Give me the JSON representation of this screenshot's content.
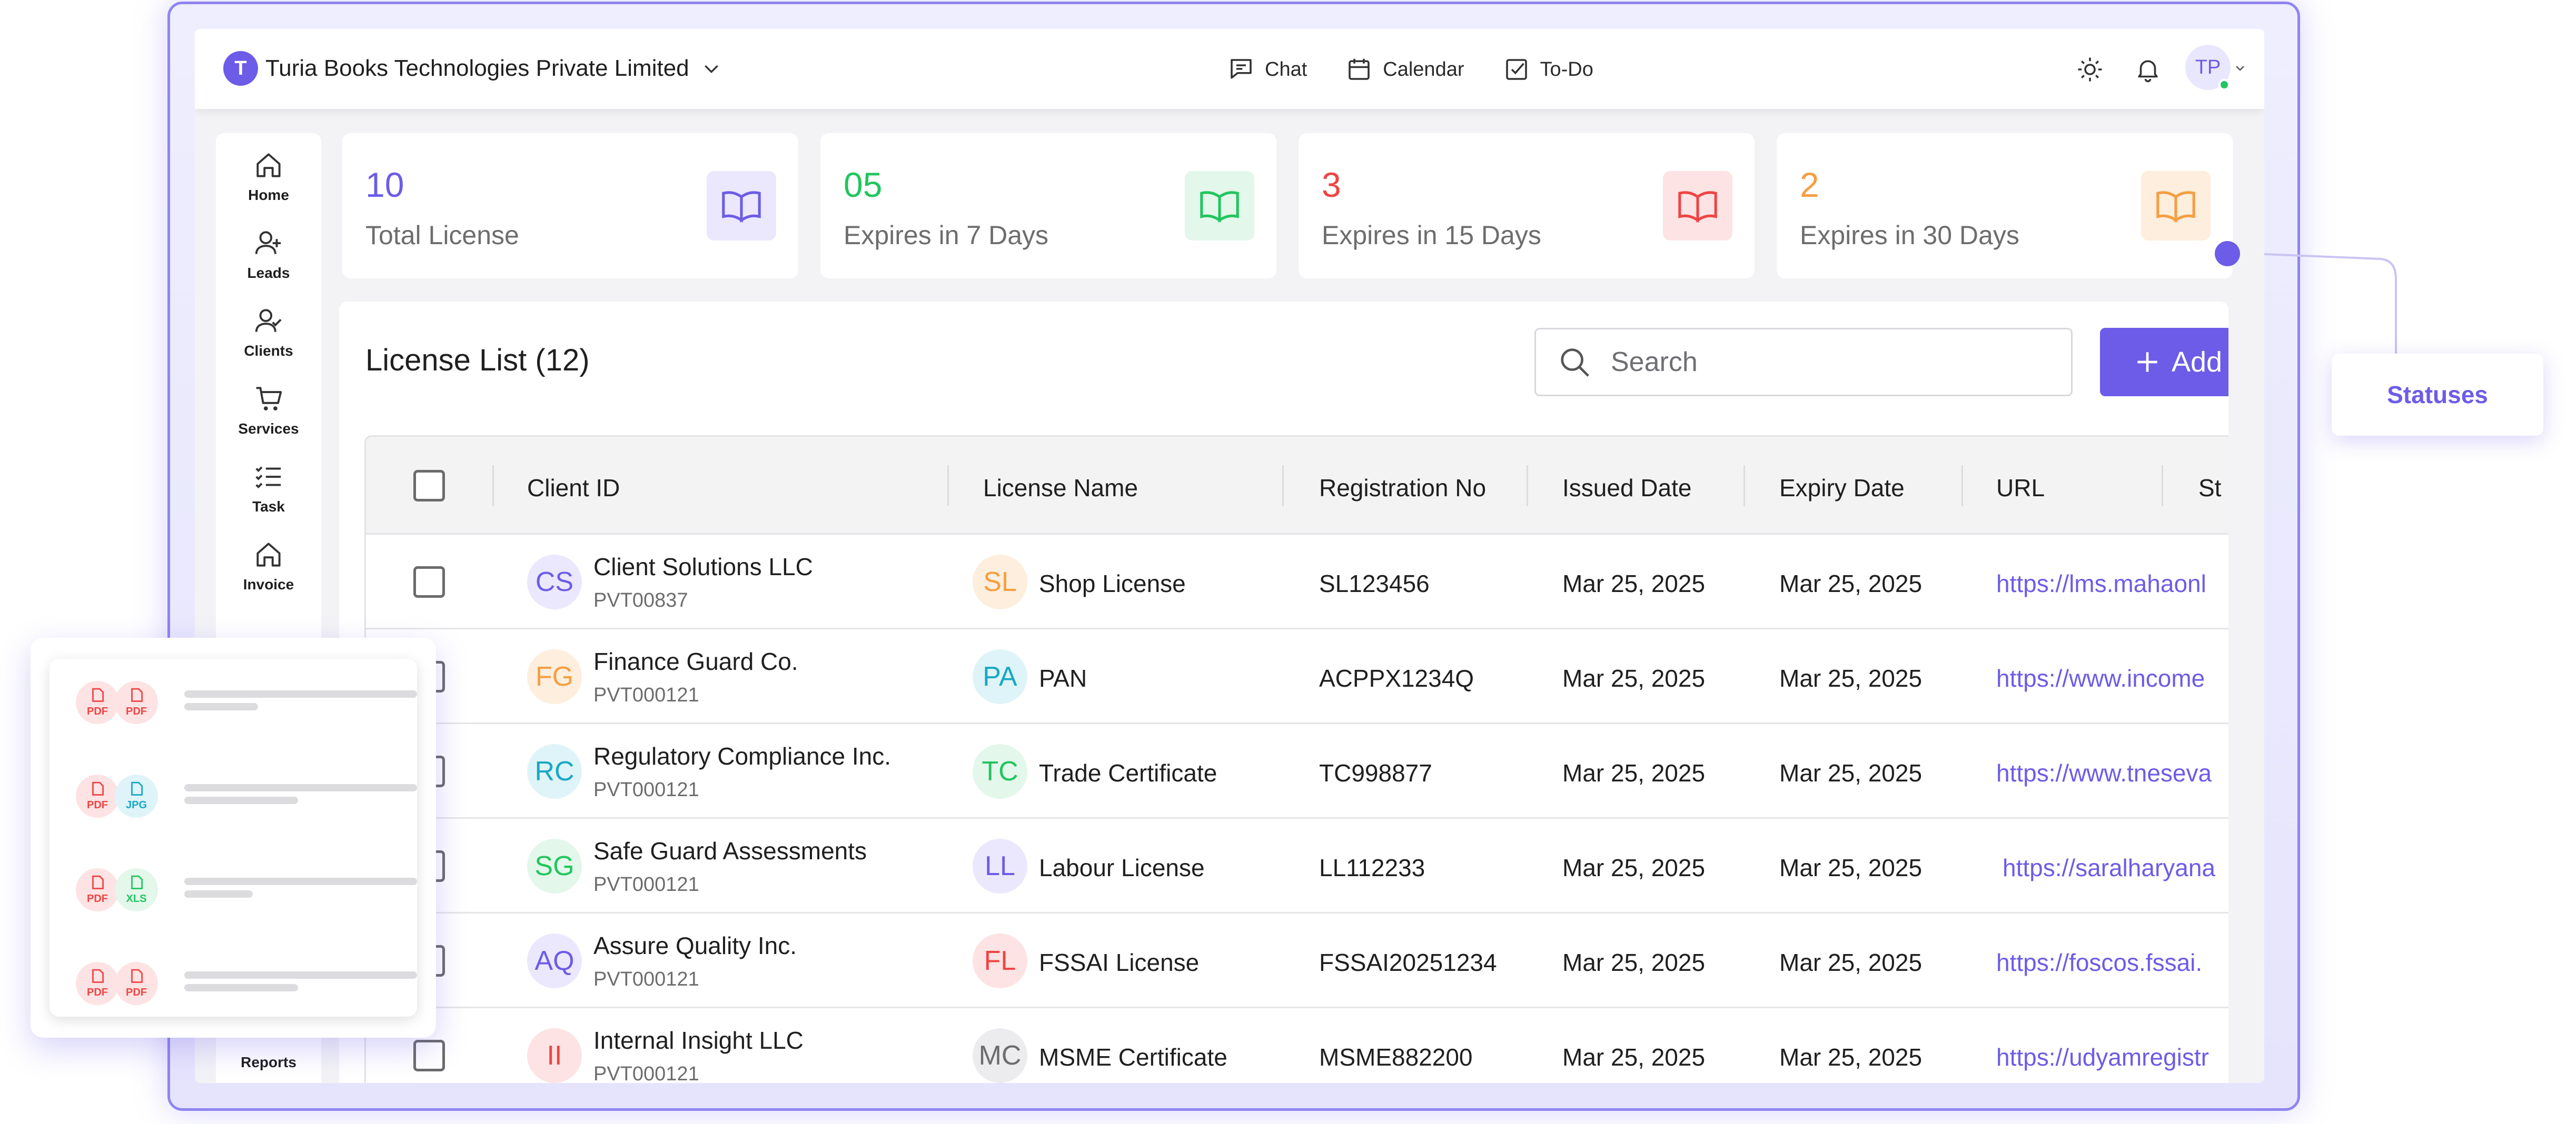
{
  "app": {
    "org_initial": "T",
    "org_name": "Turia Books Technologies Private Limited",
    "avatar_initials": "TP",
    "accent_color": "#6c5ce7"
  },
  "topnav": {
    "chat": "Chat",
    "calendar": "Calendar",
    "todo": "To-Do"
  },
  "sidebar": {
    "items": [
      {
        "label": "Home",
        "icon": "home-icon"
      },
      {
        "label": "Leads",
        "icon": "user-plus-icon"
      },
      {
        "label": "Clients",
        "icon": "user-check-icon"
      },
      {
        "label": "Services",
        "icon": "cart-icon"
      },
      {
        "label": "Task",
        "icon": "task-list-icon"
      },
      {
        "label": "Invoice",
        "icon": "invoice-icon"
      },
      {
        "label": "",
        "icon": "book-icon",
        "active": true
      },
      {
        "label": "Reports",
        "icon": "reports-icon"
      }
    ]
  },
  "stats": [
    {
      "value": "10",
      "label": "Total License",
      "color": "#6c5ce7",
      "bg": "#ebe8fd"
    },
    {
      "value": "05",
      "label": "Expires in 7 Days",
      "color": "#22c55e",
      "bg": "#e3f7eb"
    },
    {
      "value": "3",
      "label": "Expires in 15 Days",
      "color": "#ef4444",
      "bg": "#fde3e3"
    },
    {
      "value": "2",
      "label": "Expires in 30 Days",
      "color": "#f59e42",
      "bg": "#fdeedd"
    }
  ],
  "list": {
    "title": "License List (12)",
    "search_placeholder": "Search",
    "add_label": "Add"
  },
  "table": {
    "columns": [
      "Client ID",
      "License Name",
      "Registration No",
      "Issued Date",
      "Expiry Date",
      "URL",
      "St"
    ],
    "rows": [
      {
        "client_initials": "CS",
        "client_name": "Client Solutions LLC",
        "client_code": "PVT00837",
        "lic_initials": "SL",
        "license": "Shop License",
        "reg_no": "SL123456",
        "issued": "Mar 25, 2025",
        "expiry": "Mar 25, 2025",
        "url": "https://lms.mahaonl"
      },
      {
        "client_initials": "FG",
        "client_name": "Finance Guard Co.",
        "client_code": "PVT000121",
        "lic_initials": "PA",
        "license": "PAN",
        "reg_no": "ACPPX1234Q",
        "issued": "Mar 25, 2025",
        "expiry": "Mar 25, 2025",
        "url": "https://www.income"
      },
      {
        "client_initials": "RC",
        "client_name": "Regulatory Compliance Inc.",
        "client_code": "PVT000121",
        "lic_initials": "TC",
        "license": "Trade Certificate",
        "reg_no": "TC998877",
        "issued": "Mar 25, 2025",
        "expiry": "Mar 25, 2025",
        "url": "https://www.tneseva"
      },
      {
        "client_initials": "SG",
        "client_name": "Safe Guard Assessments",
        "client_code": "PVT000121",
        "lic_initials": "LL",
        "license": "Labour License",
        "reg_no": "LL112233",
        "issued": "Mar 25, 2025",
        "expiry": "Mar 25, 2025",
        "url": "https://saralharyana"
      },
      {
        "client_initials": "AQ",
        "client_name": "Assure Quality Inc.",
        "client_code": "PVT000121",
        "lic_initials": "FL",
        "license": "FSSAI License",
        "reg_no": "FSSAI20251234",
        "issued": "Mar 25, 2025",
        "expiry": "Mar 25, 2025",
        "url": "https://foscos.fssai."
      },
      {
        "client_initials": "II",
        "client_name": "Internal Insight LLC",
        "client_code": "PVT000121",
        "lic_initials": "MC",
        "license": "MSME Certificate",
        "reg_no": "MSME882200",
        "issued": "Mar 25, 2025",
        "expiry": "Mar 25, 2025",
        "url": "https://udyamregistr"
      }
    ]
  },
  "callout": {
    "label": "Statuses"
  },
  "files_card": {
    "rows": [
      {
        "badges": [
          "PDF",
          "PDF"
        ]
      },
      {
        "badges": [
          "PDF",
          "JPG"
        ]
      },
      {
        "badges": [
          "PDF",
          "XLS"
        ]
      },
      {
        "badges": [
          "PDF",
          "PDF"
        ]
      }
    ]
  }
}
